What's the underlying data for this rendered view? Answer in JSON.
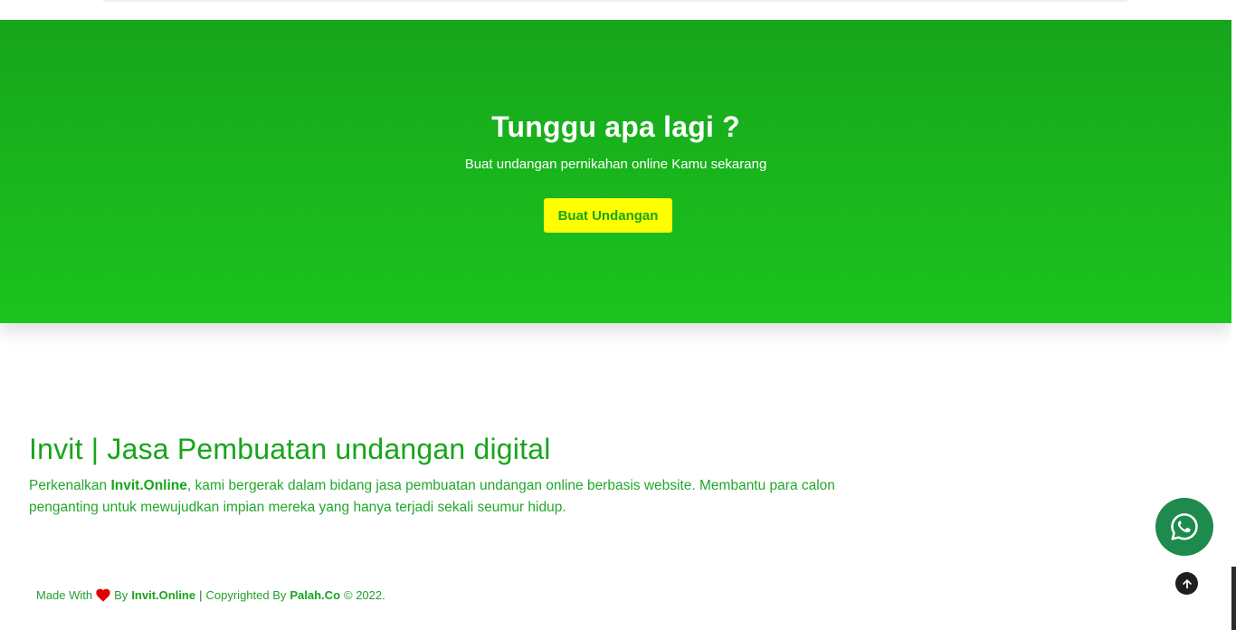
{
  "cta": {
    "title": "Tunggu apa lagi ?",
    "subtitle": "Buat undangan pernikahan online Kamu sekarang",
    "button_label": "Buat Undangan"
  },
  "about": {
    "title": "Invit | Jasa Pembuatan undangan digital",
    "desc_prefix": "Perkenalkan ",
    "desc_brand": "Invit.Online",
    "desc_suffix": ", kami bergerak dalam bidang jasa pembuatan undangan online berbasis website. Membantu para calon penganting untuk mewujudkan impian mereka yang hanya terjadi sekali seumur hidup."
  },
  "footer": {
    "made_with": "Made With",
    "by": "By",
    "brand": "Invit.Online",
    "separator": "|",
    "copyrighted_by": "Copyrighted By",
    "company": "Palah.Co",
    "copyright_year": "© 2022."
  },
  "icons": {
    "heart": "heart-icon",
    "whatsapp": "whatsapp-icon",
    "back_to_top": "arrow-up-icon"
  },
  "colors": {
    "primary_green": "#17a51b",
    "cta_button_bg": "#ffff00",
    "whatsapp_bg": "#1e8a4e",
    "heart": "#e00000"
  }
}
